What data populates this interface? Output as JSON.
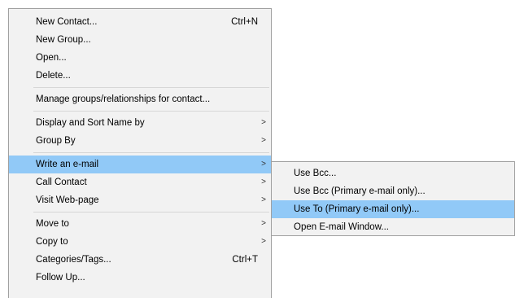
{
  "main_menu": {
    "items": [
      {
        "label": "New Contact...",
        "shortcut": "Ctrl+N"
      },
      {
        "label": "New Group..."
      },
      {
        "label": "Open..."
      },
      {
        "label": "Delete..."
      },
      {
        "label": "Manage groups/relationships for contact..."
      },
      {
        "label": "Display and Sort Name by",
        "arrow": ">"
      },
      {
        "label": "Group By",
        "arrow": ">"
      },
      {
        "label": "Write an e-mail",
        "arrow": ">"
      },
      {
        "label": "Call Contact",
        "arrow": ">"
      },
      {
        "label": "Visit Web-page",
        "arrow": ">"
      },
      {
        "label": "Move to",
        "arrow": ">"
      },
      {
        "label": "Copy to",
        "arrow": ">"
      },
      {
        "label": "Categories/Tags...",
        "shortcut": "Ctrl+T"
      },
      {
        "label": "Follow Up..."
      }
    ]
  },
  "submenu": {
    "items": [
      {
        "label": "Use Bcc..."
      },
      {
        "label": "Use Bcc (Primary e-mail only)..."
      },
      {
        "label": "Use To (Primary e-mail only)..."
      },
      {
        "label": "Open E-mail Window..."
      }
    ]
  },
  "colors": {
    "menu_bg": "#f2f2f2",
    "highlight": "#91c9f7",
    "separator": "#d7d7d7",
    "border": "#a0a0a0"
  }
}
